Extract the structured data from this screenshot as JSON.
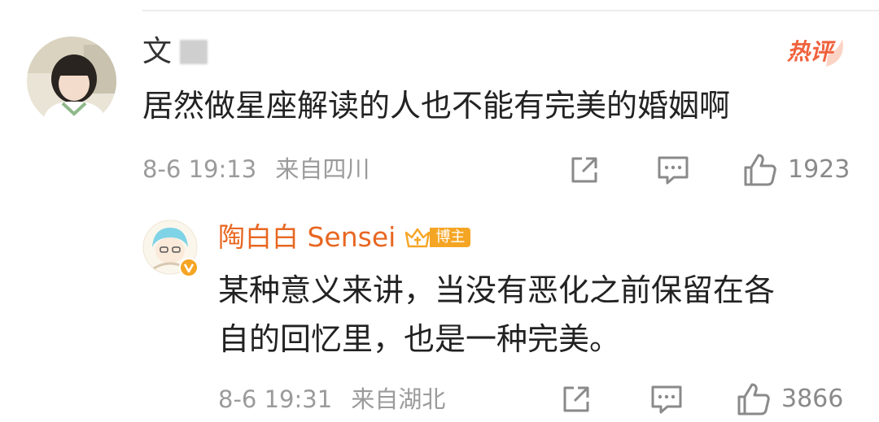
{
  "comment": {
    "username": "文",
    "hot_label": "热评",
    "text": "居然做星座解读的人也不能有完美的婚姻啊",
    "date": "8-6 19:13",
    "location": "来自四川",
    "likes": "1923"
  },
  "reply": {
    "username": "陶白白 Sensei",
    "role_badge": "博主",
    "text_line1": "某种意义来讲，当没有恶化之前保留在各",
    "text_line2": "自的回忆里，也是一种完美。",
    "date": "8-6 19:31",
    "location": "来自湖北",
    "likes": "3866"
  },
  "icons": {
    "share": "share-icon",
    "comment": "comment-icon",
    "like": "thumbs-up-icon",
    "crown": "crown-icon",
    "verified": "verified-badge-icon"
  },
  "colors": {
    "hot": "#f0623d",
    "reply_username": "#e86722",
    "badge": "#f5a524",
    "meta": "#9b9b9b"
  }
}
